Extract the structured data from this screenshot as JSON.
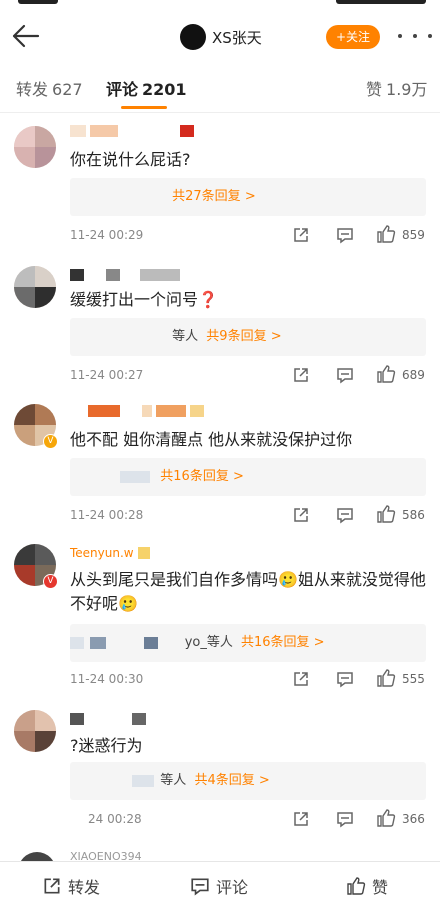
{
  "nav": {
    "title": "XS张天",
    "follow_label": "+关注"
  },
  "tabs": [
    {
      "label": "转发",
      "count": "627"
    },
    {
      "label": "评论",
      "count": "2201"
    },
    {
      "label": "赞",
      "count": "1.9万"
    }
  ],
  "comments": [
    {
      "text": "你在说什么屁话?",
      "replies_who": "",
      "replies_more": "共27条回复 >",
      "time": "11-24 00:29",
      "likes": "859"
    },
    {
      "text": "缓缓打出一个问号❓",
      "replies_who": "等人",
      "replies_more": "共9条回复 >",
      "time": "11-24 00:27",
      "likes": "689"
    },
    {
      "text": "他不配 姐你清醒点 他从来就没保护过你",
      "replies_who": "",
      "replies_more": "共16条回复 >",
      "time": "11-24 00:28",
      "likes": "586"
    },
    {
      "name_fragment": "Teenyun.w",
      "text": "从头到尾只是我们自作多情吗🥲姐从来就没觉得他不好呢🥲",
      "replies_who": "yo_等人",
      "replies_more": "共16条回复 >",
      "time": "11-24 00:30",
      "likes": "555"
    },
    {
      "text": "?迷惑行为",
      "replies_who": "等人",
      "replies_more": "共4条回复 >",
      "time": "24 00:28",
      "likes": "366"
    }
  ],
  "next_comment_name": "XIAOENO394",
  "bottom": {
    "repost": "转发",
    "comment": "评论",
    "like": "赞"
  },
  "colors": {
    "accent": "#ff8200",
    "reply_bg": "#f5f5f5"
  }
}
